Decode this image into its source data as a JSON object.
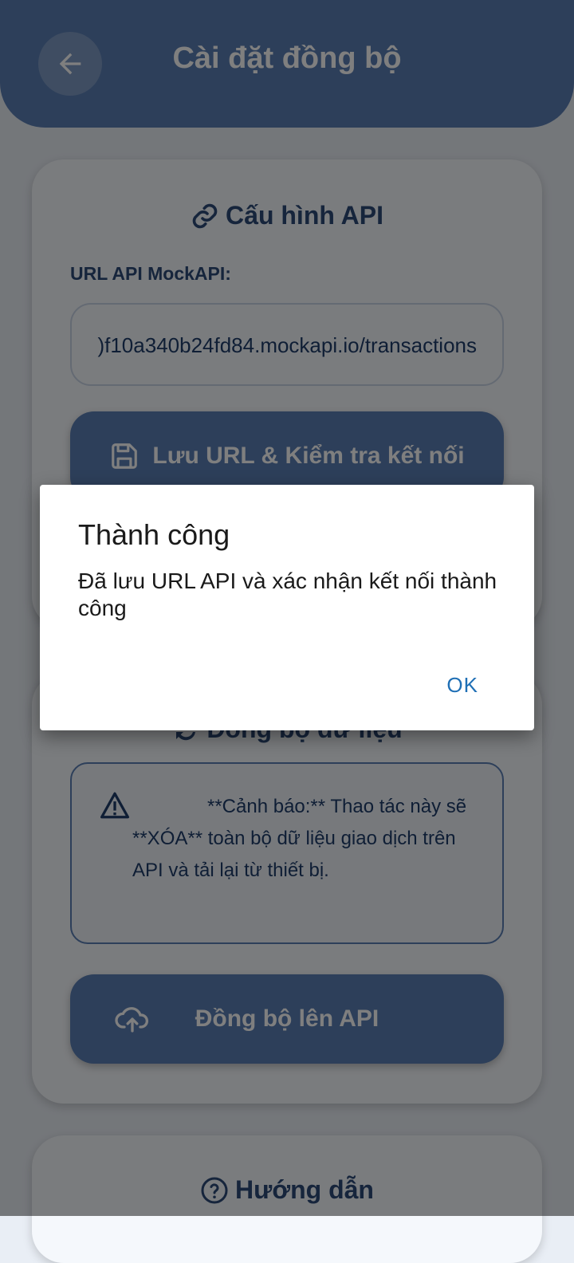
{
  "header": {
    "title": "Cài đặt đồng bộ",
    "back_icon": "arrow-left-icon"
  },
  "api_card": {
    "title": "Cấu hình API",
    "title_icon": "link-icon",
    "url_label": "URL API MockAPI:",
    "url_value": ")f10a340b24fd84.mockapi.io/transactions",
    "save_button": "Lưu URL & Kiểm tra kết nối",
    "save_icon": "save-icon"
  },
  "sync_card": {
    "title": "Đồng bộ dữ liệu",
    "title_icon": "sync-icon",
    "warning_text": "**Cảnh báo:** Thao tác này sẽ **XÓA** toàn bộ dữ liệu giao dịch trên API và tải lại từ thiết bị.",
    "warning_icon": "warning-triangle-icon",
    "upload_button": "Đồng bộ lên API",
    "upload_icon": "cloud-upload-icon"
  },
  "guide_card": {
    "title": "Hướng dẫn",
    "title_icon": "help-circle-icon"
  },
  "dialog": {
    "title": "Thành công",
    "message": "Đã lưu URL API và xác nhận kết nối thành công",
    "ok_label": "OK"
  },
  "colors": {
    "primary": "#5b7fb5",
    "dark_text": "#2c4a78",
    "ok_button": "#1f6fb5"
  }
}
